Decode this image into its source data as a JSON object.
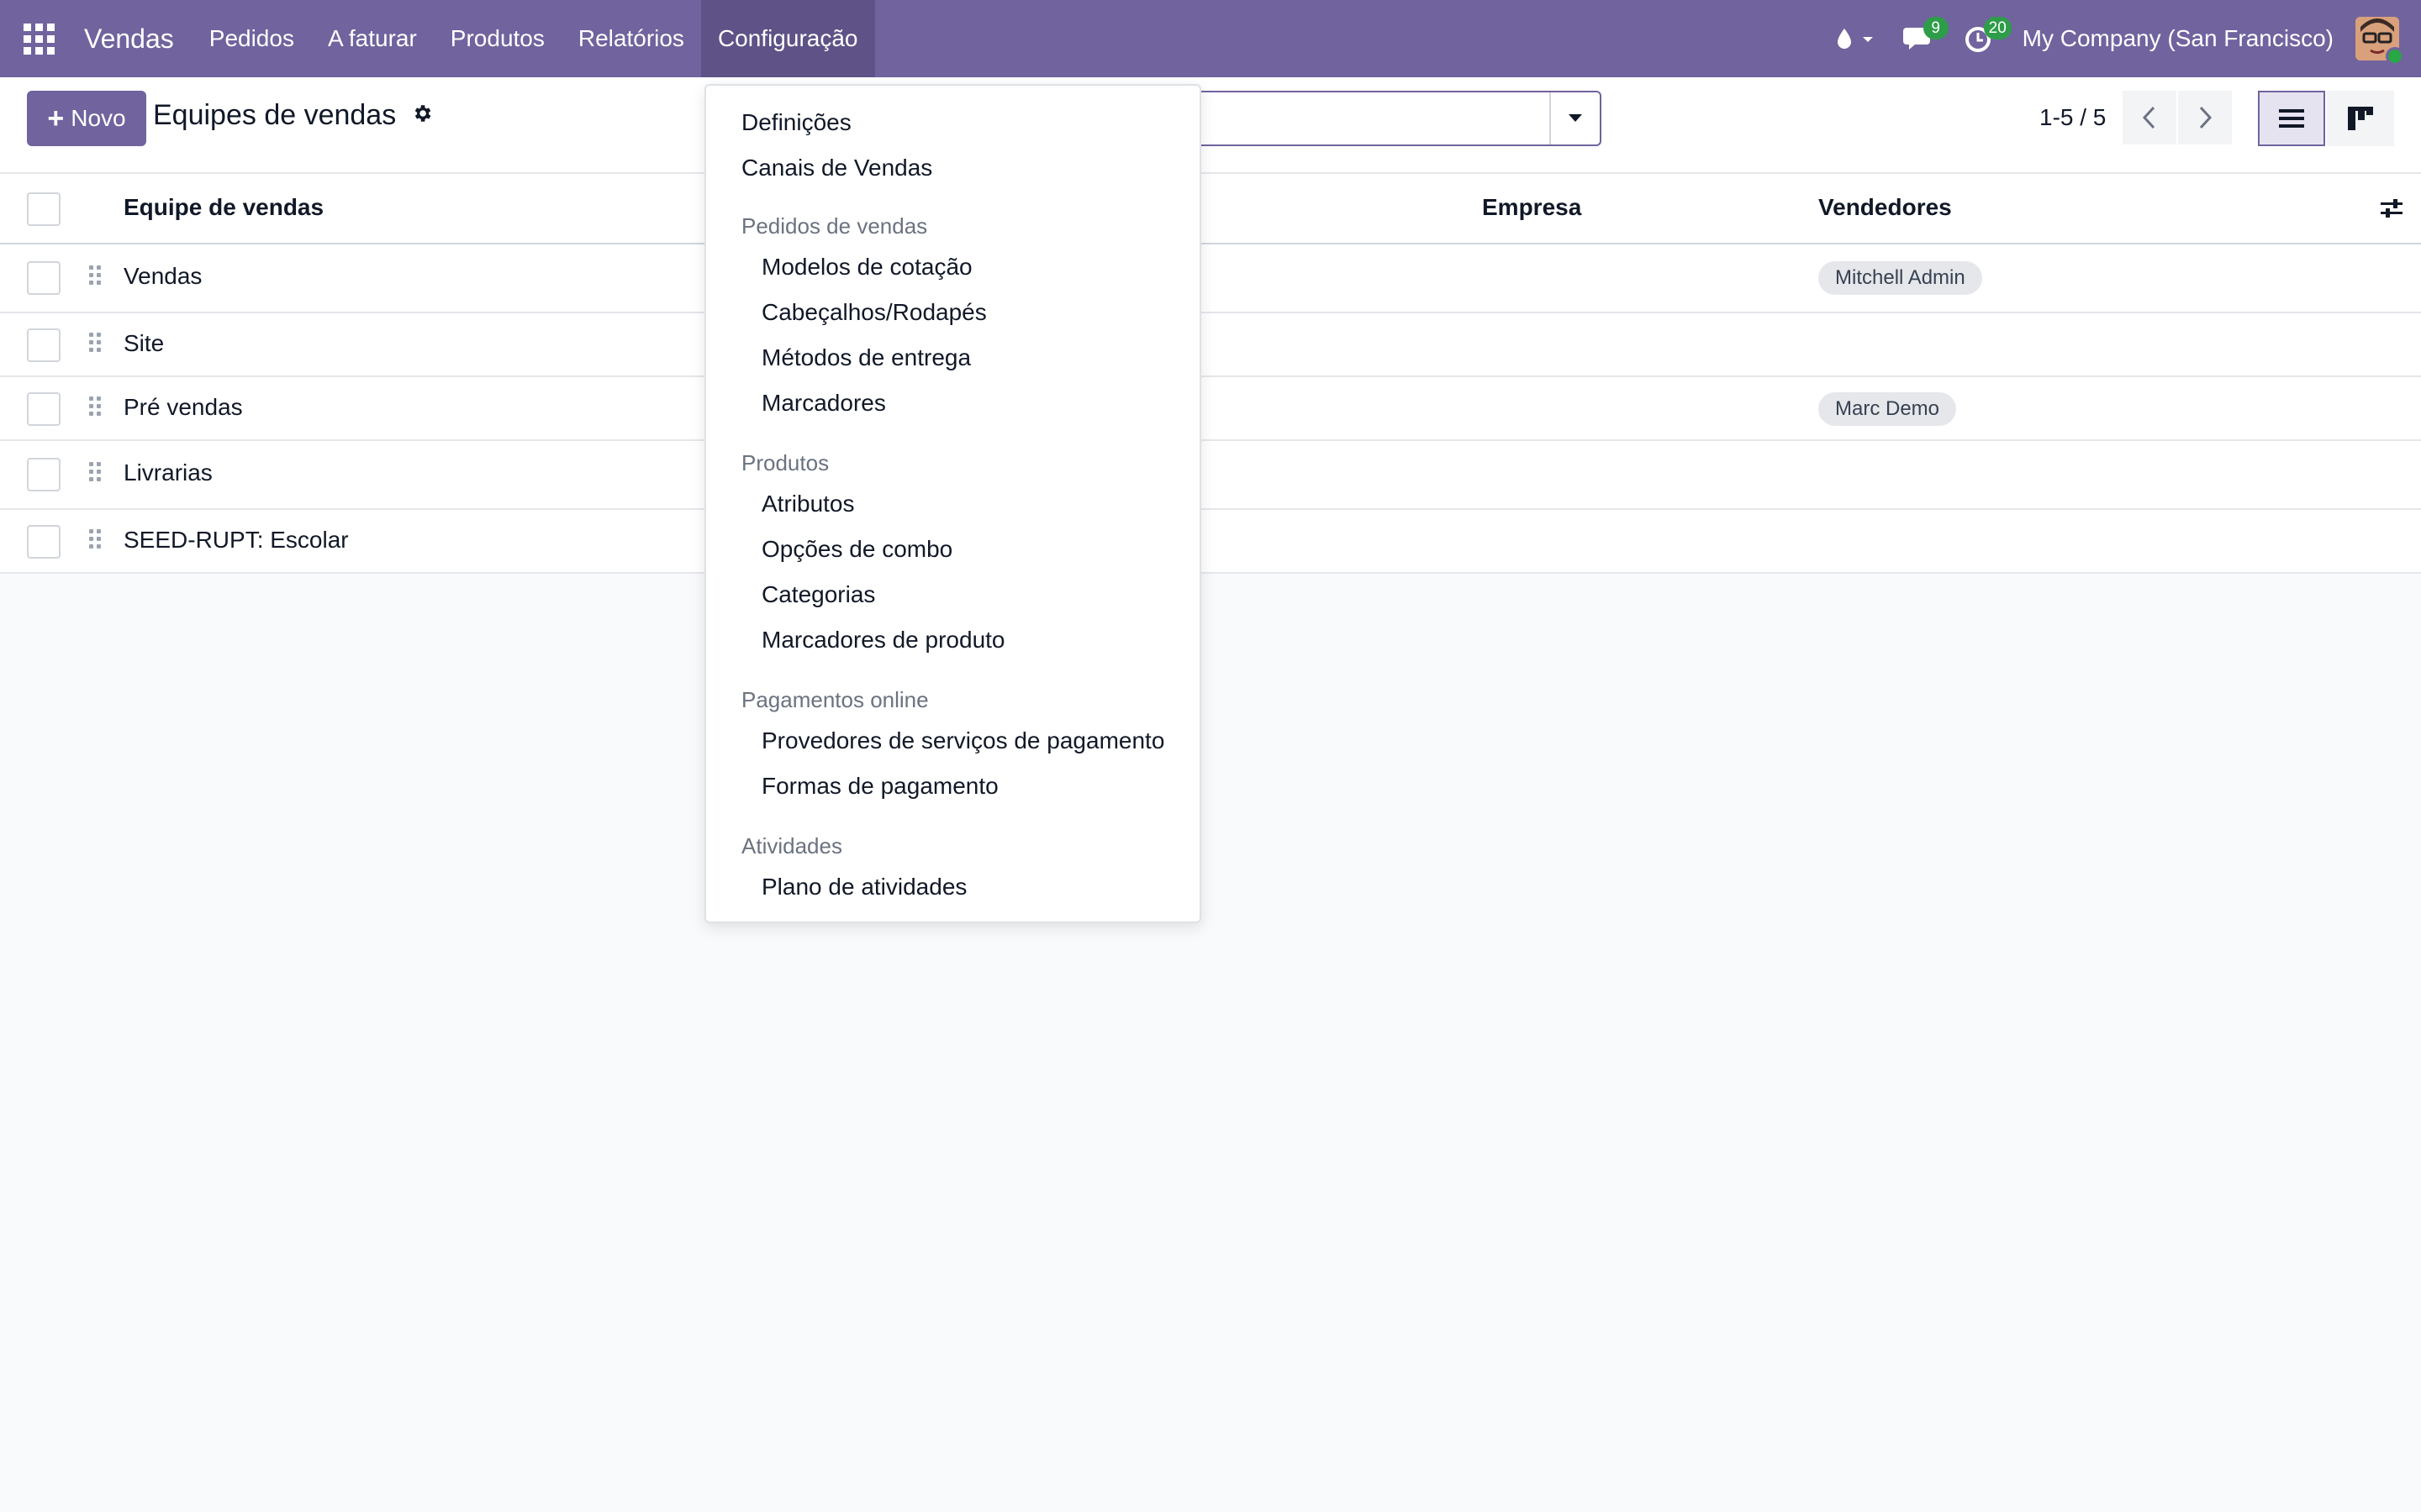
{
  "navbar": {
    "app_name": "Vendas",
    "menu": [
      {
        "label": "Pedidos"
      },
      {
        "label": "A faturar"
      },
      {
        "label": "Produtos"
      },
      {
        "label": "Relatórios"
      },
      {
        "label": "Configuração"
      }
    ],
    "messages_count": "9",
    "activities_count": "20",
    "company": "My Company (San Francisco)"
  },
  "control_panel": {
    "new_button": "Novo",
    "breadcrumb": "Equipes de vendas",
    "pager": "1-5 / 5"
  },
  "table": {
    "columns": {
      "team": "Equipe de vendas",
      "company": "Empresa",
      "salespeople": "Vendedores"
    },
    "rows": [
      {
        "name": "Vendas",
        "salesperson": "Mitchell Admin"
      },
      {
        "name": "Site",
        "salesperson": ""
      },
      {
        "name": "Pré vendas",
        "salesperson": "Marc Demo"
      },
      {
        "name": "Livrarias",
        "salesperson": ""
      },
      {
        "name": "SEED-RUPT: Escolar",
        "salesperson": ""
      }
    ]
  },
  "dropdown": {
    "items": [
      "Definições",
      "Canais de Vendas"
    ],
    "sections": [
      {
        "header": "Pedidos de vendas",
        "items": [
          "Modelos de cotação",
          "Cabeçalhos/Rodapés",
          "Métodos de entrega",
          "Marcadores"
        ]
      },
      {
        "header": "Produtos",
        "items": [
          "Atributos",
          "Opções de combo",
          "Categorias",
          "Marcadores de produto"
        ]
      },
      {
        "header": "Pagamentos online",
        "items": [
          "Provedores de serviços de pagamento",
          "Formas de pagamento"
        ]
      },
      {
        "header": "Atividades",
        "items": [
          "Plano de atividades"
        ]
      }
    ]
  },
  "colors": {
    "brand": "#71639e",
    "badge": "#2e9d49"
  }
}
